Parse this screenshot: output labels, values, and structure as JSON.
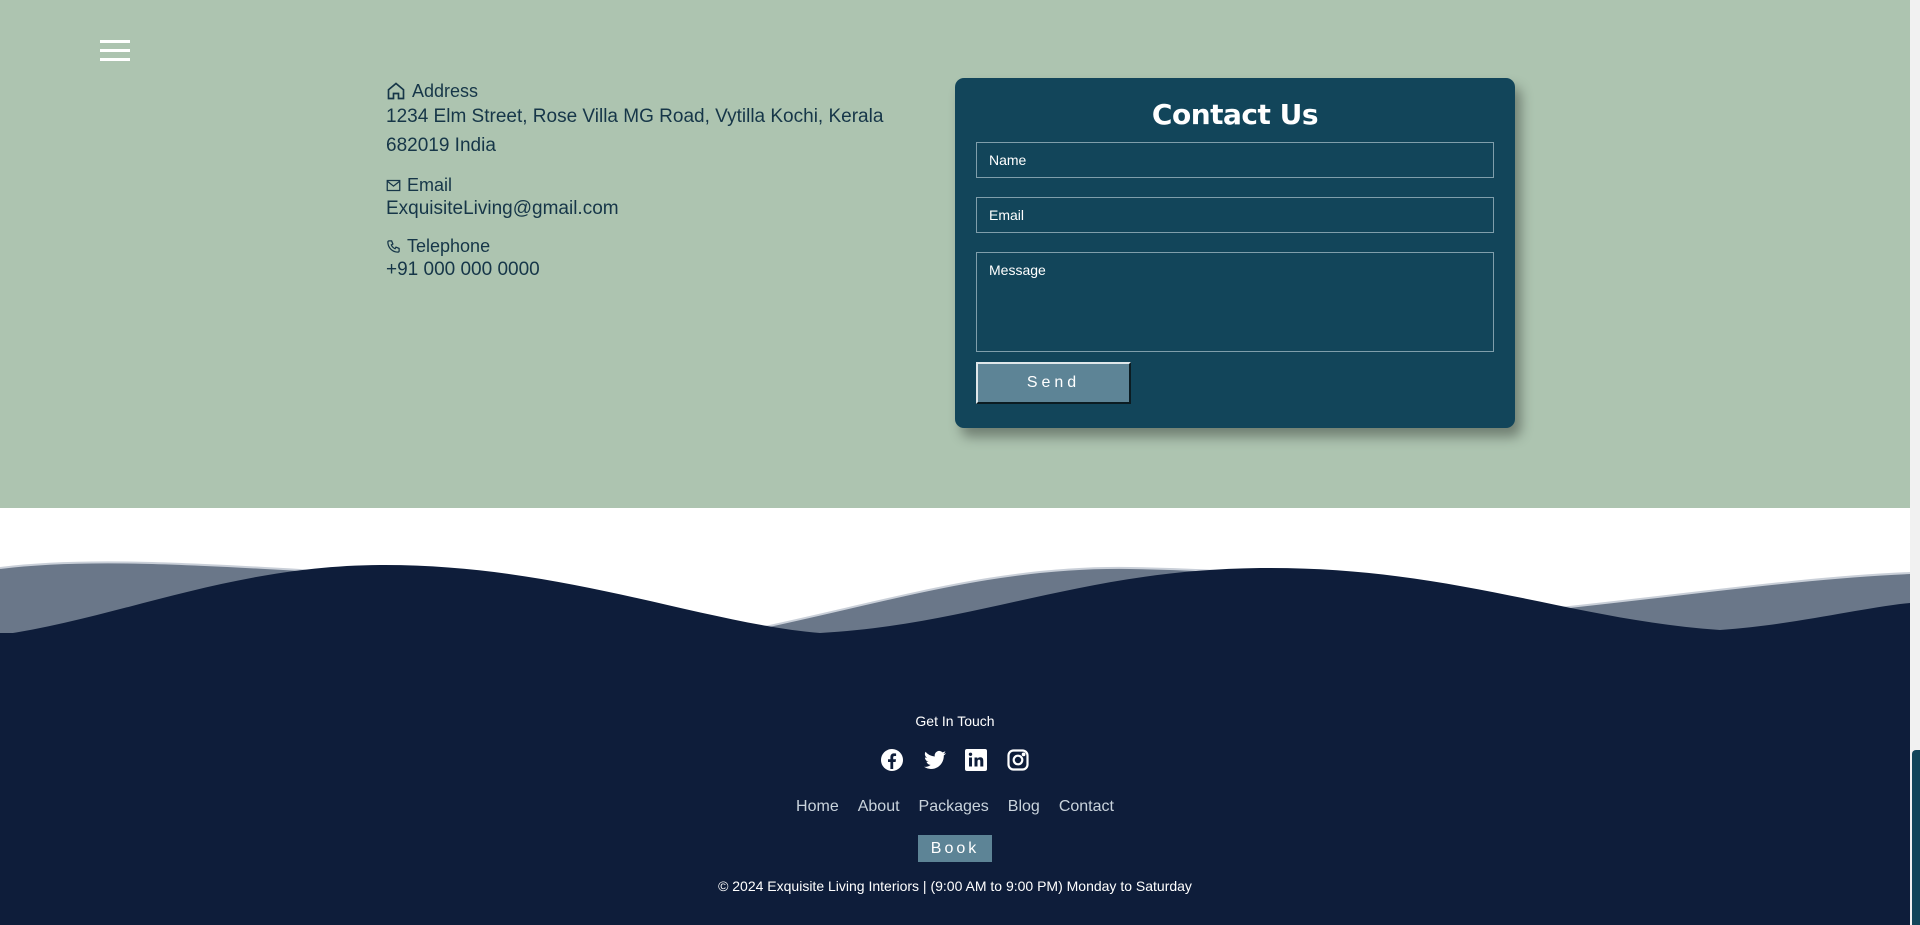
{
  "menu": {
    "icon": "hamburger-icon"
  },
  "contact_info": {
    "address": {
      "icon": "home-icon",
      "label": "Address",
      "value": "1234 Elm Street, Rose Villa MG Road, Vytilla Kochi, Kerala 682019 India"
    },
    "email": {
      "icon": "mail-icon",
      "label": "Email",
      "value": "ExquisiteLiving@gmail.com"
    },
    "telephone": {
      "icon": "phone-icon",
      "label": "Telephone",
      "value": "+91 000 000 0000"
    }
  },
  "form": {
    "title": "Contact Us",
    "name_placeholder": "Name",
    "email_placeholder": "Email",
    "message_placeholder": "Message",
    "send_label": "Send"
  },
  "footer": {
    "heading": "Get In Touch",
    "socials": [
      "facebook-icon",
      "twitter-icon",
      "linkedin-icon",
      "instagram-icon"
    ],
    "nav": [
      "Home",
      "About",
      "Packages",
      "Blog",
      "Contact"
    ],
    "book_label": "Book",
    "copyright": "© 2024 Exquisite Living Interiors | (9:00 AM to 9:00 PM) Monday to Saturday"
  },
  "colors": {
    "section_bg": "#adc4b0",
    "card_bg": "#12455a",
    "footer_bg": "#0e1d3a",
    "accent": "#5d8496",
    "text_dark": "#163648"
  }
}
